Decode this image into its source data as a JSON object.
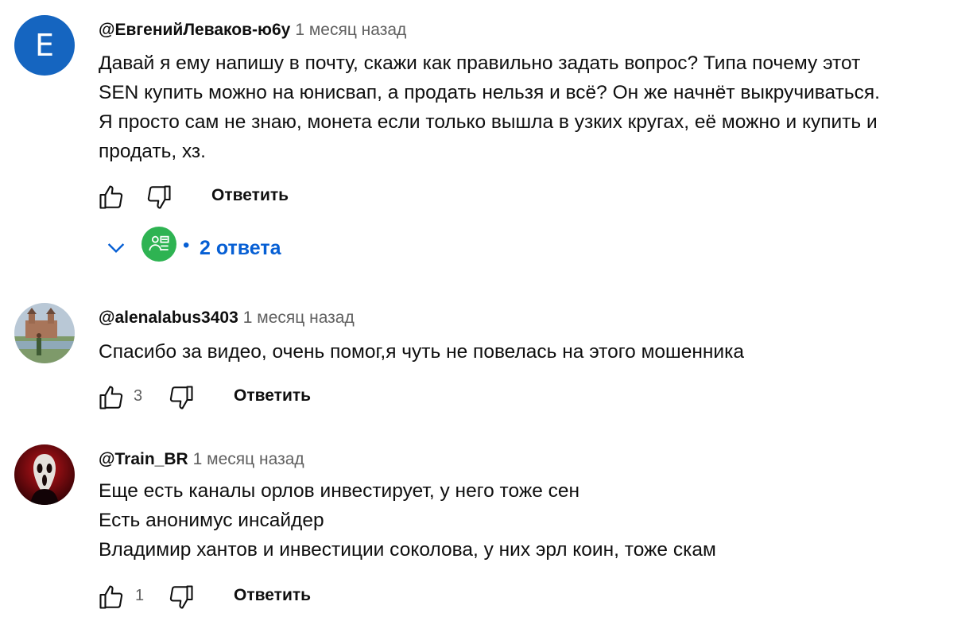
{
  "comments": [
    {
      "author": "@ЕвгенийЛеваков-ю6у",
      "time": "1 месяц назад",
      "avatar_letter": "E",
      "avatar_color": "#1565c0",
      "lines": [
        "Давай я ему напишу в почту, скажи как правильно задать вопрос? Типа почему этот",
        "SEN купить можно на юнисвап, а продать нельзя и всё? Он же начнёт выкручиваться.",
        "Я просто сам не знаю, монета если только вышла в узких кругах, её можно и купить и",
        "продать, хз."
      ],
      "likes": "",
      "reply_label": "Ответить",
      "replies": {
        "dot": "•",
        "label": "2 ответа",
        "avatar_color": "#2eb352"
      }
    },
    {
      "author": "@alenalabus3403",
      "time": "1 месяц назад",
      "lines": [
        "Спасибо за видео, очень помог,я чуть не повелась на этого мошенника"
      ],
      "likes": "3",
      "reply_label": "Ответить"
    },
    {
      "author": "@Train_BR",
      "time": "1 месяц назад",
      "lines": [
        "Еще есть каналы орлов инвестирует, у него тоже сен",
        "Есть анонимус инсайдер",
        "Владимир хантов и инвестиции соколова, у них эрл коин, тоже скам"
      ],
      "likes": "1",
      "reply_label": "Ответить"
    }
  ],
  "colors": {
    "link_blue": "#065fd4",
    "secondary_text": "#606060"
  }
}
